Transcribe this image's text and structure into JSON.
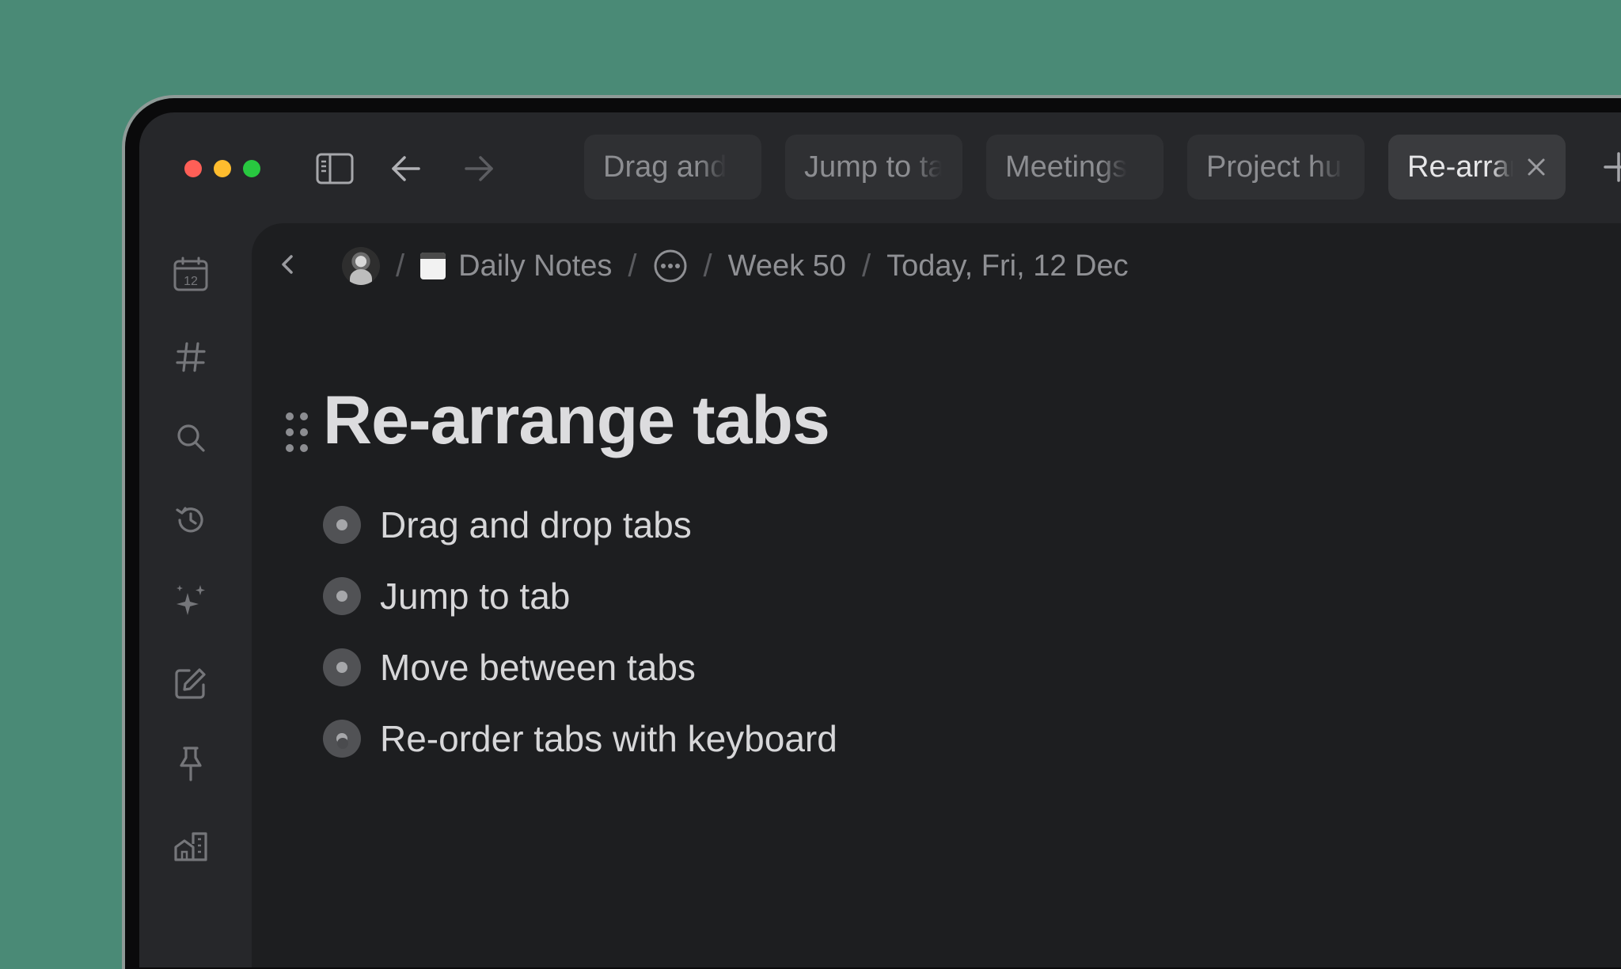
{
  "tabs": [
    {
      "label": "Drag and",
      "active": false
    },
    {
      "label": "Jump to tab",
      "active": false
    },
    {
      "label": "Meetings",
      "active": false
    },
    {
      "label": "Project hub",
      "active": false
    },
    {
      "label": "Re-arrange tabs",
      "active": true
    }
  ],
  "toolbar": {
    "icons": [
      "sidebar-toggle-icon",
      "back-arrow-icon",
      "forward-arrow-icon",
      "plus-icon"
    ]
  },
  "sidebar": {
    "icons": [
      {
        "name": "calendar-icon",
        "text": "12"
      },
      {
        "name": "hashtag-icon"
      },
      {
        "name": "search-icon"
      },
      {
        "name": "history-icon"
      },
      {
        "name": "sparkles-icon"
      },
      {
        "name": "edit-icon"
      },
      {
        "name": "pin-icon"
      },
      {
        "name": "home-icon"
      }
    ]
  },
  "breadcrumb": {
    "separator": "/",
    "daily_notes": "Daily Notes",
    "week": "Week 50",
    "today": "Today, Fri, 12 Dec"
  },
  "page": {
    "title": "Re-arrange tabs",
    "items": [
      "Drag and drop tabs",
      "Jump to tab",
      "Move between tabs",
      "Re-order tabs with keyboard"
    ]
  },
  "colors": {
    "background": "#4a8a76",
    "window": "#26272a",
    "content": "#1d1e20",
    "close": "#fe5f57",
    "minimize": "#febc2e",
    "maximize": "#28c840"
  }
}
